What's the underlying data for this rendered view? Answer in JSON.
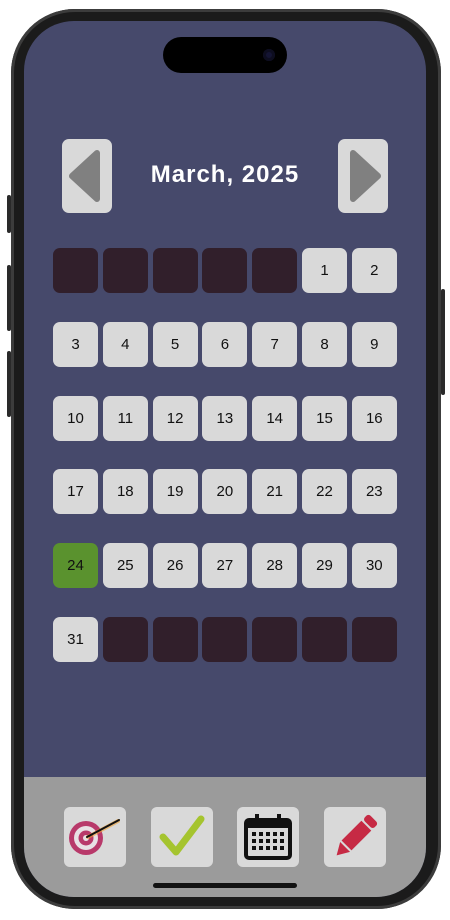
{
  "calendar": {
    "month_label": "March, 2025",
    "leading_blanks": 5,
    "days": [
      "1",
      "2",
      "3",
      "4",
      "5",
      "6",
      "7",
      "8",
      "9",
      "10",
      "11",
      "12",
      "13",
      "14",
      "15",
      "16",
      "17",
      "18",
      "19",
      "20",
      "21",
      "22",
      "23",
      "24",
      "25",
      "26",
      "27",
      "28",
      "29",
      "30",
      "31"
    ],
    "selected_day": "24",
    "prev_icon": "triangle-left-icon",
    "next_icon": "triangle-right-icon"
  },
  "toolbar": {
    "items": [
      {
        "icon": "target-dart-icon"
      },
      {
        "icon": "checkmark-icon"
      },
      {
        "icon": "calendar-icon"
      },
      {
        "icon": "pencil-icon"
      }
    ]
  },
  "colors": {
    "background": "#46496b",
    "day_cell": "#d9d9d9",
    "empty_cell": "#311f2b",
    "selected_day": "#5a922e",
    "toolbar": "#9b9b9b"
  }
}
